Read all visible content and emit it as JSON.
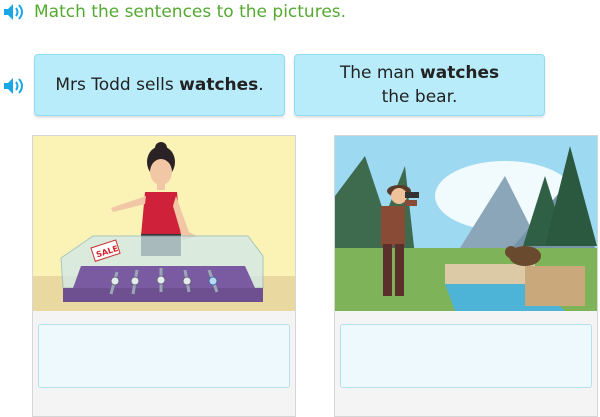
{
  "instruction": {
    "text": "Match the sentences to the pictures.",
    "color": "#55a930",
    "icon": "speaker-icon"
  },
  "answers": [
    {
      "pre": "Mrs Todd sells ",
      "bold": "watches",
      "post": "."
    },
    {
      "pre": "The man ",
      "bold": "watches",
      "post": " the bear."
    }
  ],
  "pictures": [
    {
      "scene": "woman-selling-watches",
      "sign": "SALE"
    },
    {
      "scene": "man-watching-bear"
    }
  ],
  "colors": {
    "tile": "#b9ecfb",
    "accent": "#1aa7e8"
  }
}
